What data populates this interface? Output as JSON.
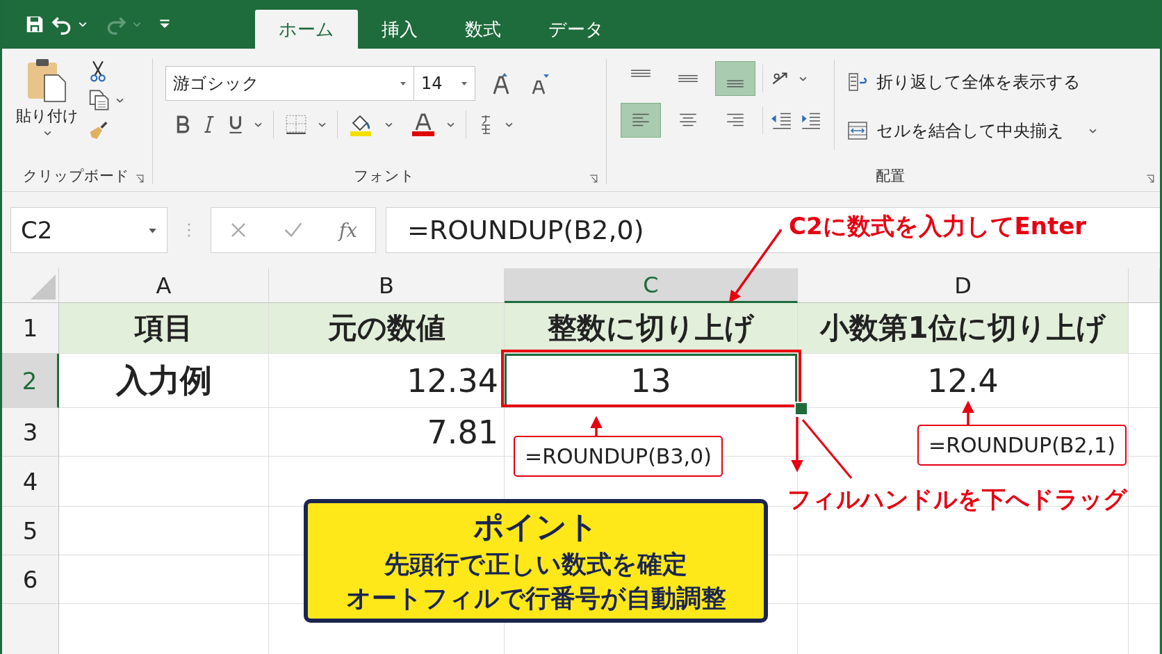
{
  "tabs": [
    {
      "label": "ホーム",
      "selected": true
    },
    {
      "label": "挿入",
      "selected": false
    },
    {
      "label": "数式",
      "selected": false
    },
    {
      "label": "データ",
      "selected": false
    }
  ],
  "ribbon": {
    "clipboard": {
      "paste_label": "貼り付け",
      "group_label": "クリップボード"
    },
    "font": {
      "font_name": "游ゴシック",
      "font_size": "14",
      "group_label": "フォント"
    },
    "alignment": {
      "vertical_buttons": [
        {
          "selected": false
        },
        {
          "selected": false
        },
        {
          "selected": true
        }
      ],
      "horizontal_buttons": [
        {
          "selected": true
        },
        {
          "selected": false
        },
        {
          "selected": false
        }
      ],
      "wrap_text": "折り返して全体を表示する",
      "merge": "セルを結合して中央揃え",
      "group_label": "配置"
    }
  },
  "formula_bar": {
    "name_box": "C2",
    "fx_label": "fx",
    "formula": "=ROUNDUP(B2,0)"
  },
  "sheet": {
    "columns": [
      {
        "label": "A",
        "selected": false
      },
      {
        "label": "B",
        "selected": false
      },
      {
        "label": "C",
        "selected": true
      },
      {
        "label": "D",
        "selected": false
      }
    ],
    "rows": [
      {
        "number": "1",
        "kind": "header",
        "selected": false,
        "cells": [
          {
            "text": "項目",
            "selected": false
          },
          {
            "text": "元の数値",
            "selected": false
          },
          {
            "text": "整数に切り上げ",
            "selected": false
          },
          {
            "text": "小数第1位に切り上げ",
            "selected": false
          }
        ]
      },
      {
        "number": "2",
        "kind": "data",
        "selected": true,
        "cells": [
          {
            "text": "入力例",
            "bold": true,
            "selected": false
          },
          {
            "text": "12.34",
            "selected": false
          },
          {
            "text": "13",
            "selected": true
          },
          {
            "text": "12.4",
            "selected": false
          }
        ]
      },
      {
        "number": "3",
        "kind": "data",
        "selected": false,
        "cells": [
          {
            "selected": false
          },
          {
            "text": "7.81",
            "selected": false
          },
          {
            "selected": false
          },
          {
            "selected": false
          }
        ]
      },
      {
        "number": "4",
        "kind": "data",
        "selected": false,
        "cells": [
          {
            "selected": false
          },
          {
            "selected": false
          },
          {
            "selected": false
          },
          {
            "selected": false
          }
        ]
      },
      {
        "number": "5",
        "kind": "data",
        "selected": false,
        "cells": [
          {
            "selected": false
          },
          {
            "selected": false
          },
          {
            "selected": false
          },
          {
            "selected": false
          }
        ]
      },
      {
        "number": "6",
        "kind": "data",
        "selected": false,
        "cells": [
          {
            "selected": false
          },
          {
            "selected": false
          },
          {
            "selected": false
          },
          {
            "selected": false
          }
        ]
      }
    ]
  },
  "annotations": [
    {
      "kind": "callout",
      "text": "C2に数式を入力してEnter"
    },
    {
      "kind": "formula_box",
      "text": "=ROUNDUP(B3,0)"
    },
    {
      "kind": "formula_box",
      "text": "=ROUNDUP(B2,1)"
    },
    {
      "kind": "callout",
      "text": "フィルハンドルを下へドラッグ"
    }
  ],
  "point": {
    "title": "ポイント",
    "lines": [
      "先頭行で正しい数式を確定",
      "オートフィルで行番号が自動調整"
    ]
  }
}
